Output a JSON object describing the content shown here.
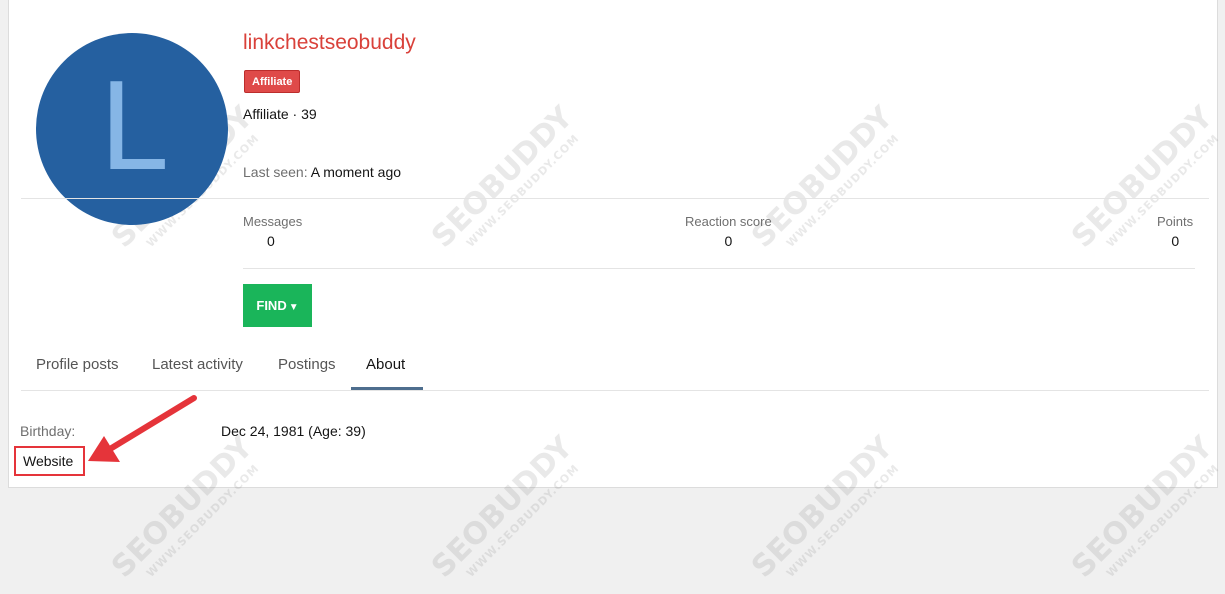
{
  "profile": {
    "avatar_letter": "L",
    "username": "linkchestseobuddy",
    "badge": "Affiliate",
    "role_line": "Affiliate · 39",
    "last_seen_label": "Last seen:",
    "last_seen_value": "A moment ago"
  },
  "stats": [
    {
      "label": "Messages",
      "value": "0"
    },
    {
      "label": "Reaction score",
      "value": "0"
    },
    {
      "label": "Points",
      "value": "0"
    }
  ],
  "find_button": {
    "label": "FIND"
  },
  "tabs": [
    {
      "label": "Profile posts"
    },
    {
      "label": "Latest activity"
    },
    {
      "label": "Postings"
    },
    {
      "label": "About",
      "active": true
    }
  ],
  "about": {
    "birthday_label": "Birthday:",
    "birthday_value": "Dec 24, 1981 (Age: 39)",
    "website_label": "Website"
  },
  "watermark": {
    "brand": "SEOBUDDY",
    "url": "WWW.SEOBUDDY.COM"
  },
  "colors": {
    "username": "#d9413a",
    "badge": "#df4a49",
    "find_button": "#1ab55a",
    "avatar": "#2560a0",
    "highlight": "#e5343a"
  }
}
